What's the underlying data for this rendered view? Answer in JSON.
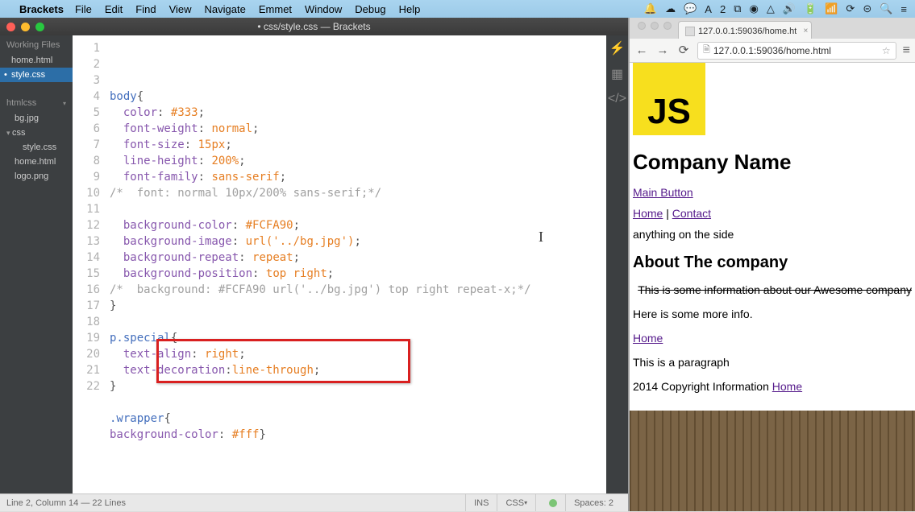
{
  "mac_menu": {
    "app_name": "Brackets",
    "items": [
      "File",
      "Edit",
      "Find",
      "View",
      "Navigate",
      "Emmet",
      "Window",
      "Debug",
      "Help"
    ]
  },
  "brackets": {
    "title": "• css/style.css — Brackets",
    "sidebar": {
      "working_files_label": "Working Files",
      "working_files": [
        "home.html",
        "style.css"
      ],
      "project_label": "htmlcss",
      "project_files": [
        {
          "name": "bg.jpg",
          "type": "file",
          "indent": 1
        },
        {
          "name": "css",
          "type": "folder",
          "indent": 0
        },
        {
          "name": "style.css",
          "type": "file",
          "indent": 2
        },
        {
          "name": "home.html",
          "type": "file",
          "indent": 1
        },
        {
          "name": "logo.png",
          "type": "file",
          "indent": 1
        }
      ]
    },
    "active_file_index": 1,
    "gutter_start": 1,
    "gutter_end": 22,
    "code_lines": [
      {
        "n": 1,
        "html": "<span class='sel'>body</span><span class='punct'>{</span>"
      },
      {
        "n": 2,
        "html": "  <span class='prp'>color</span><span class='punct'>:</span> <span class='hex'>#333</span><span class='punct'>;</span>"
      },
      {
        "n": 3,
        "html": "  <span class='prp'>font-weight</span><span class='punct'>:</span> <span class='val'>normal</span><span class='punct'>;</span>"
      },
      {
        "n": 4,
        "html": "  <span class='prp'>font-size</span><span class='punct'>:</span> <span class='val'>15px</span><span class='punct'>;</span>"
      },
      {
        "n": 5,
        "html": "  <span class='prp'>line-height</span><span class='punct'>:</span> <span class='val'>200%</span><span class='punct'>;</span>"
      },
      {
        "n": 6,
        "html": "  <span class='prp'>font-family</span><span class='punct'>:</span> <span class='val'>sans-serif</span><span class='punct'>;</span>"
      },
      {
        "n": 7,
        "html": "<span class='cmt'>/*  font: normal 10px/200% sans-serif;*/</span>"
      },
      {
        "n": 8,
        "html": ""
      },
      {
        "n": 9,
        "html": "  <span class='prp'>background-color</span><span class='punct'>:</span> <span class='hex'>#FCFA90</span><span class='punct'>;</span>"
      },
      {
        "n": 10,
        "html": "  <span class='prp'>background-image</span><span class='punct'>:</span> <span class='val'>url('../bg.jpg')</span><span class='punct'>;</span>"
      },
      {
        "n": 11,
        "html": "  <span class='prp'>background-repeat</span><span class='punct'>:</span> <span class='val'>repeat</span><span class='punct'>;</span>"
      },
      {
        "n": 12,
        "html": "  <span class='prp'>background-position</span><span class='punct'>:</span> <span class='val'>top right</span><span class='punct'>;</span>"
      },
      {
        "n": 13,
        "html": "<span class='cmt'>/*  background: #FCFA90 url('../bg.jpg') top right repeat-x;*/</span>"
      },
      {
        "n": 14,
        "html": "<span class='punct'>}</span>"
      },
      {
        "n": 15,
        "html": ""
      },
      {
        "n": 16,
        "html": "<span class='sel'>p.special</span><span class='punct'>{</span>"
      },
      {
        "n": 17,
        "html": "  <span class='prp'>text-align</span><span class='punct'>:</span> <span class='val'>right</span><span class='punct'>;</span>"
      },
      {
        "n": 18,
        "html": "  <span class='prp'>text-decoration</span><span class='punct'>:</span><span class='val'>line-through</span><span class='punct'>;</span>"
      },
      {
        "n": 19,
        "html": "<span class='punct'>}</span>"
      },
      {
        "n": 20,
        "html": ""
      },
      {
        "n": 21,
        "html": "<span class='sel'>.wrapper</span><span class='punct'>{</span>"
      },
      {
        "n": 22,
        "html": "<span class='prp'>background-color</span><span class='punct'>:</span> <span class='hex'>#fff</span><span class='punct'>}</span>"
      }
    ],
    "statusbar": {
      "position": "Line 2, Column 14 — 22 Lines",
      "ins": "INS",
      "lang": "CSS",
      "spaces": "Spaces: 2"
    }
  },
  "chrome": {
    "tab_title": "127.0.0.1:59036/home.ht",
    "url": "127.0.0.1:59036/home.html",
    "page": {
      "logo_text": "JS",
      "h1": "Company Name",
      "main_button": "Main Button",
      "nav_home": "Home",
      "nav_contact": "Contact",
      "aside": "anything on the side",
      "h2": "About The company",
      "strike_text": "This is some information about our Awesome company",
      "p_more": "Here is some more info.",
      "link_home2": "Home",
      "p_para": "This is a paragraph",
      "footer_text": "2014 Copyright Information ",
      "footer_link": "Home"
    }
  }
}
